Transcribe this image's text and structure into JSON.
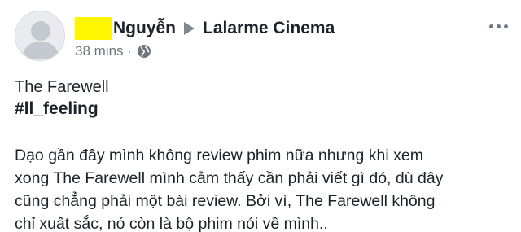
{
  "post": {
    "author_name": "Nguyễn",
    "destination": "Lalarme Cinema",
    "timestamp": "38 mins",
    "separator": "·",
    "privacy_icon": "globe-icon",
    "more_icon": "more-horizontal-icon",
    "title": "The Farewell",
    "hashtag": "#ll_feeling",
    "body_lines": [
      "Dạo gần đây mình không review phim nữa nhưng khi xem",
      "xong The Farewell mình cảm thấy cần phải viết gì đó, dù đây",
      "cũng chẳng phải một bài review. Bởi vì, The Farewell không",
      "chỉ xuất sắc, nó còn là bộ phim nói về mình.."
    ]
  },
  "colors": {
    "text": "#1d2129",
    "meta": "#70757c",
    "redaction": "#fff500",
    "avatar_bg": "#e9ebee",
    "avatar_fg": "#c4c9d0"
  }
}
